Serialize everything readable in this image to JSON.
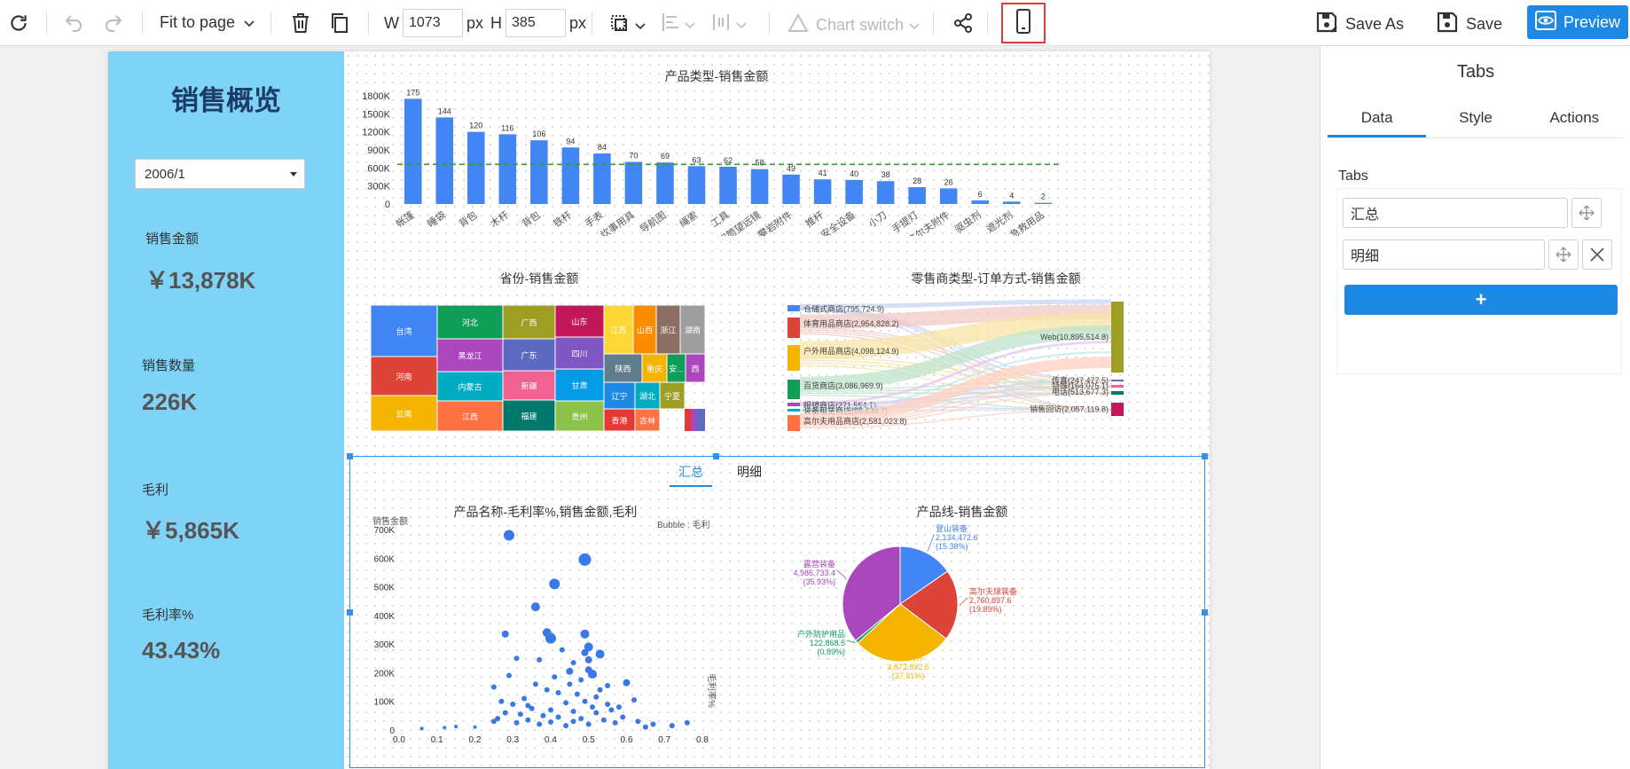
{
  "toolbar": {
    "fit_label": "Fit to page",
    "w_label": "W",
    "w_value": "1073",
    "w_unit": "px",
    "h_label": "H",
    "h_value": "385",
    "h_unit": "px",
    "chart_switch_label": "Chart switch",
    "save_as_label": "Save As",
    "save_label": "Save",
    "preview_label": "Preview",
    "highlight_color": "#e53935",
    "accent_color": "#1e88e5"
  },
  "dashboard": {
    "title": "销售概览",
    "date_value": "2006/1",
    "kpis": [
      {
        "label": "销售金额",
        "value": "￥13,878K"
      },
      {
        "label": "销售数量",
        "value": "226K"
      },
      {
        "label": "毛利",
        "value": "￥5,865K"
      },
      {
        "label": "毛利率%",
        "value": "43.43%"
      }
    ],
    "sidebar_color": "#7ed3f7"
  },
  "tabs_widget": {
    "tabs": [
      "汇总",
      "明细"
    ],
    "active": 0
  },
  "right_panel": {
    "title": "Tabs",
    "tabs": [
      "Data",
      "Style",
      "Actions"
    ],
    "section_label": "Tabs",
    "items": [
      "汇总",
      "明细"
    ],
    "add_label": "+"
  },
  "chart_data": [
    {
      "type": "bar",
      "title": "产品类型-销售金额",
      "categories": [
        "帐篷",
        "睡袋",
        "背包",
        "木杆",
        "背包",
        "铁杆",
        "手表",
        "炊事用具",
        "导航图",
        "绳索",
        "工具",
        "双筒望远镜",
        "攀岩附件",
        "推杆",
        "安全设备",
        "小刀",
        "手提灯",
        "高尔夫附件",
        "驱虫剂",
        "遮光剂",
        "急救用品"
      ],
      "labels": [
        "175",
        "144",
        "120",
        "116",
        "106",
        "94",
        "84",
        "70",
        "69",
        "63",
        "62",
        "58",
        "49",
        "41",
        "40",
        "38",
        "28",
        "26",
        "6",
        "4",
        "2"
      ],
      "values": [
        1750000,
        1440000,
        1200000,
        1160000,
        1060000,
        940000,
        840000,
        700000,
        690000,
        630000,
        620000,
        580000,
        490000,
        410000,
        400000,
        380000,
        280000,
        260000,
        60000,
        40000,
        20000
      ],
      "yticks": [
        "1800K",
        "1500K",
        "1200K",
        "900K",
        "600K",
        "300K",
        "0"
      ],
      "ylim": [
        0,
        1800000
      ],
      "average_line": 660000,
      "color": "#4285f4"
    },
    {
      "type": "treemap",
      "title": "省份-销售金额",
      "items": [
        {
          "name": "台湾",
          "color": "#4285f4"
        },
        {
          "name": "河南",
          "color": "#db4437"
        },
        {
          "name": "云南",
          "color": "#f4b400"
        },
        {
          "name": "河北",
          "color": "#0f9d58"
        },
        {
          "name": "黑龙江",
          "color": "#ab47bc"
        },
        {
          "name": "内蒙古",
          "color": "#00acc1"
        },
        {
          "name": "江西",
          "color": "#ff7043"
        },
        {
          "name": "广西",
          "color": "#9e9d24"
        },
        {
          "name": "广东",
          "color": "#5c6bc0"
        },
        {
          "name": "新疆",
          "color": "#f06292"
        },
        {
          "name": "福建",
          "color": "#00796b"
        },
        {
          "name": "山东",
          "color": "#c2185b"
        },
        {
          "name": "四川",
          "color": "#7e57c2"
        },
        {
          "name": "甘肃",
          "color": "#039be5"
        },
        {
          "name": "贵州",
          "color": "#8bc34a"
        },
        {
          "name": "江苏",
          "color": "#fdd835"
        },
        {
          "name": "山西",
          "color": "#fb8c00"
        },
        {
          "name": "浙江",
          "color": "#8d6e63"
        },
        {
          "name": "湖南",
          "color": "#9e9e9e"
        },
        {
          "name": "陕西",
          "color": "#607d8b"
        },
        {
          "name": "重庆",
          "color": "#f4b400"
        },
        {
          "name": "安...",
          "color": "#0f9d58"
        },
        {
          "name": "西",
          "color": "#ab47bc"
        },
        {
          "name": "辽宁",
          "color": "#1e88e5"
        },
        {
          "name": "湖北",
          "color": "#00acc1"
        },
        {
          "name": "宁夏",
          "color": "#9e9d24"
        },
        {
          "name": "香港",
          "color": "#e53935"
        },
        {
          "name": "吉林",
          "color": "#ff7043"
        }
      ]
    },
    {
      "type": "sankey",
      "title": "零售商类型-订单方式-销售金额",
      "sources": [
        {
          "label": "仓储式商店(795,724.9)",
          "color": "#4285f4"
        },
        {
          "label": "体育用品商店(2,954,828.2)",
          "color": "#db4437"
        },
        {
          "label": "户外用品商店(4,098,124.9)",
          "color": "#f4b400"
        },
        {
          "label": "百货商店(3,086,969.9)",
          "color": "#0f9d58"
        },
        {
          "label": "眼镜商店(271,554.1)",
          "color": "#ab47bc"
        },
        {
          "label": "装备租赁商店(89,638.7)",
          "color": "#00acc1"
        },
        {
          "label": "高尔夫用品商店(2,581,023.8)",
          "color": "#ff7043"
        }
      ],
      "targets": [
        {
          "label": "Web(10,895,514.8)",
          "color": "#9e9d24"
        },
        {
          "label": "传真(247,477.5)",
          "color": "#5c6bc0"
        },
        {
          "label": "特殊(164,075.1)",
          "color": "#f06292"
        },
        {
          "label": "电话(513,677.3)",
          "color": "#00796b"
        },
        {
          "label": "销售回访(2,057,119.8)",
          "color": "#c2185b"
        }
      ]
    },
    {
      "type": "scatter",
      "title": "产品名称-毛利率%,销售金额,毛利",
      "ylabel": "销售金额",
      "xlabel": "毛利率%",
      "bubble_label": "Bubble : 毛利",
      "xticks": [
        "0.0",
        "0.1",
        "0.2",
        "0.3",
        "0.4",
        "0.5",
        "0.6",
        "0.7",
        "0.8"
      ],
      "yticks": [
        "700K",
        "600K",
        "500K",
        "400K",
        "300K",
        "200K",
        "100K",
        "0"
      ],
      "xlim": [
        0,
        0.8
      ],
      "ylim": [
        0,
        700000
      ],
      "color": "#3b78e7",
      "points": [
        {
          "x": 0.29,
          "y": 680000,
          "r": 6
        },
        {
          "x": 0.49,
          "y": 595000,
          "r": 7
        },
        {
          "x": 0.41,
          "y": 510000,
          "r": 6
        },
        {
          "x": 0.36,
          "y": 430000,
          "r": 5
        },
        {
          "x": 0.39,
          "y": 340000,
          "r": 5
        },
        {
          "x": 0.4,
          "y": 320000,
          "r": 6
        },
        {
          "x": 0.49,
          "y": 335000,
          "r": 5
        },
        {
          "x": 0.28,
          "y": 335000,
          "r": 4
        },
        {
          "x": 0.5,
          "y": 290000,
          "r": 5
        },
        {
          "x": 0.53,
          "y": 265000,
          "r": 5
        },
        {
          "x": 0.49,
          "y": 270000,
          "r": 4
        },
        {
          "x": 0.5,
          "y": 245000,
          "r": 4
        },
        {
          "x": 0.43,
          "y": 280000,
          "r": 3
        },
        {
          "x": 0.46,
          "y": 235000,
          "r": 3
        },
        {
          "x": 0.37,
          "y": 245000,
          "r": 3
        },
        {
          "x": 0.31,
          "y": 250000,
          "r": 3
        },
        {
          "x": 0.5,
          "y": 210000,
          "r": 4
        },
        {
          "x": 0.45,
          "y": 205000,
          "r": 4
        },
        {
          "x": 0.51,
          "y": 195000,
          "r": 5
        },
        {
          "x": 0.41,
          "y": 185000,
          "r": 3
        },
        {
          "x": 0.48,
          "y": 175000,
          "r": 3
        },
        {
          "x": 0.25,
          "y": 150000,
          "r": 3
        },
        {
          "x": 0.29,
          "y": 190000,
          "r": 3
        },
        {
          "x": 0.6,
          "y": 165000,
          "r": 4
        },
        {
          "x": 0.55,
          "y": 155000,
          "r": 3
        },
        {
          "x": 0.36,
          "y": 160000,
          "r": 3
        },
        {
          "x": 0.39,
          "y": 140000,
          "r": 3
        },
        {
          "x": 0.42,
          "y": 130000,
          "r": 3
        },
        {
          "x": 0.47,
          "y": 125000,
          "r": 3
        },
        {
          "x": 0.52,
          "y": 115000,
          "r": 3
        },
        {
          "x": 0.33,
          "y": 110000,
          "r": 3
        },
        {
          "x": 0.3,
          "y": 90000,
          "r": 3
        },
        {
          "x": 0.27,
          "y": 100000,
          "r": 3
        },
        {
          "x": 0.44,
          "y": 95000,
          "r": 3
        },
        {
          "x": 0.49,
          "y": 100000,
          "r": 3
        },
        {
          "x": 0.55,
          "y": 90000,
          "r": 3
        },
        {
          "x": 0.62,
          "y": 105000,
          "r": 3
        },
        {
          "x": 0.58,
          "y": 80000,
          "r": 3
        },
        {
          "x": 0.35,
          "y": 75000,
          "r": 3
        },
        {
          "x": 0.4,
          "y": 70000,
          "r": 3
        },
        {
          "x": 0.46,
          "y": 65000,
          "r": 3
        },
        {
          "x": 0.52,
          "y": 60000,
          "r": 3
        },
        {
          "x": 0.28,
          "y": 60000,
          "r": 3
        },
        {
          "x": 0.32,
          "y": 55000,
          "r": 3
        },
        {
          "x": 0.38,
          "y": 50000,
          "r": 3
        },
        {
          "x": 0.42,
          "y": 45000,
          "r": 3
        },
        {
          "x": 0.48,
          "y": 40000,
          "r": 3
        },
        {
          "x": 0.54,
          "y": 35000,
          "r": 3
        },
        {
          "x": 0.25,
          "y": 30000,
          "r": 3
        },
        {
          "x": 0.31,
          "y": 25000,
          "r": 3
        },
        {
          "x": 0.37,
          "y": 20000,
          "r": 3
        },
        {
          "x": 0.44,
          "y": 15000,
          "r": 3
        },
        {
          "x": 0.5,
          "y": 20000,
          "r": 3
        },
        {
          "x": 0.57,
          "y": 25000,
          "r": 3
        },
        {
          "x": 0.63,
          "y": 30000,
          "r": 3
        },
        {
          "x": 0.67,
          "y": 20000,
          "r": 3
        },
        {
          "x": 0.72,
          "y": 15000,
          "r": 3
        },
        {
          "x": 0.76,
          "y": 25000,
          "r": 3
        },
        {
          "x": 0.06,
          "y": 5000,
          "r": 2
        },
        {
          "x": 0.12,
          "y": 8000,
          "r": 2
        },
        {
          "x": 0.15,
          "y": 12000,
          "r": 2
        },
        {
          "x": 0.2,
          "y": 10000,
          "r": 2
        },
        {
          "x": 0.26,
          "y": 40000,
          "r": 3
        },
        {
          "x": 0.34,
          "y": 35000,
          "r": 3
        },
        {
          "x": 0.4,
          "y": 28000,
          "r": 3
        },
        {
          "x": 0.46,
          "y": 30000,
          "r": 3
        },
        {
          "x": 0.59,
          "y": 45000,
          "r": 3
        },
        {
          "x": 0.65,
          "y": 10000,
          "r": 3
        },
        {
          "x": 0.56,
          "y": 70000,
          "r": 3
        },
        {
          "x": 0.51,
          "y": 80000,
          "r": 3
        },
        {
          "x": 0.34,
          "y": 85000,
          "r": 3
        },
        {
          "x": 0.45,
          "y": 160000,
          "r": 3
        },
        {
          "x": 0.53,
          "y": 140000,
          "r": 3
        }
      ]
    },
    {
      "type": "pie",
      "title": "产品线-销售金额",
      "slices": [
        {
          "name": "登山装备",
          "value": "2,134,472.6",
          "pct": "(15.38%)",
          "share": 15.38,
          "color": "#4285f4"
        },
        {
          "name": "高尔夫球装备",
          "value": "2,760,897.6",
          "pct": "(19.89%)",
          "share": 19.89,
          "color": "#db4437"
        },
        {
          "name": "个人附件",
          "value": "3,872,892.5",
          "pct": "(27.91%)",
          "share": 27.91,
          "color": "#f4b400"
        },
        {
          "name": "户外防护用品",
          "value": "122,868.5",
          "pct": "(0.89%)",
          "share": 0.89,
          "color": "#0f9d58"
        },
        {
          "name": "露营装备",
          "value": "4,986,733.4",
          "pct": "(35.93%)",
          "share": 35.93,
          "color": "#ab47bc"
        }
      ]
    }
  ]
}
